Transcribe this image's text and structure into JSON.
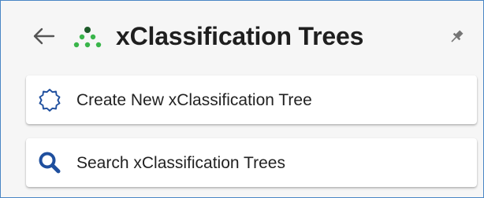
{
  "panel": {
    "title": "xClassification Trees",
    "icons": {
      "back": "back-arrow-icon",
      "logo": "classification-tree-icon",
      "pin": "pin-icon"
    }
  },
  "actions": [
    {
      "label": "Create New xClassification Tree",
      "icon": "badge-outline-icon",
      "icon_color": "#1f4f9e"
    },
    {
      "label": "Search xClassification Trees",
      "icon": "search-icon",
      "icon_color": "#1f4f9e"
    }
  ],
  "colors": {
    "panel_border": "#4a86c5",
    "panel_bg": "#f6f6f6",
    "logo_green": "#39b54a",
    "logo_dark": "#1e5b2a"
  }
}
